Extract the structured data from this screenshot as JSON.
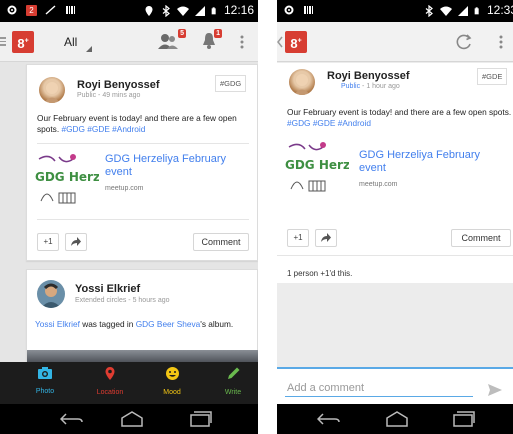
{
  "left": {
    "status": {
      "time": "12:16",
      "notif_count": "2"
    },
    "appbar": {
      "stream": "All",
      "notifications_badge": "5",
      "bell_badge": "1"
    },
    "post1": {
      "author": "Royi Benyossef",
      "visibility": "Public",
      "time": "49 mins ago",
      "hashtag_chip": "#GDG",
      "text": "Our February event is today! and there are a few open spots.",
      "tags": "#GDG  #GDE  #Android",
      "link_title": "GDG Herzeliya February event",
      "link_domain": "meetup.com",
      "plus_one": "+1",
      "comment": "Comment"
    },
    "post2": {
      "author": "Yossi Elkrief",
      "meta": "Extended circles - 5 hours ago",
      "text_name": "Yossi Elkrief",
      "text_middle": " was tagged in ",
      "text_link": "GDG Beer Sheva",
      "text_end": "'s album."
    },
    "actions": [
      {
        "label": "Photo",
        "color": "#33b5e5"
      },
      {
        "label": "Location",
        "color": "#e03c31"
      },
      {
        "label": "Mood",
        "color": "#f3c614"
      },
      {
        "label": "Write",
        "color": "#6aba4e"
      }
    ]
  },
  "right": {
    "status": {
      "time": "12:33"
    },
    "post": {
      "author": "Royi Benyossef",
      "visibility": "Public",
      "time": "1 hour ago",
      "hashtag_chip": "#GDE",
      "text": "Our February event is today! and there are a few open spots.",
      "tags": "#GDG  #GDE  #Android",
      "link_title": "GDG Herzeliya February event",
      "link_domain": "meetup.com",
      "plus_one": "+1",
      "comment": "Comment",
      "plus_ones_text": "1 person +1'd this."
    },
    "comment_box": {
      "placeholder": "Add a comment"
    }
  },
  "colors": {
    "gplus_red": "#d73d32",
    "link_blue": "#427fed",
    "accent_blue": "#5aa9e6"
  }
}
